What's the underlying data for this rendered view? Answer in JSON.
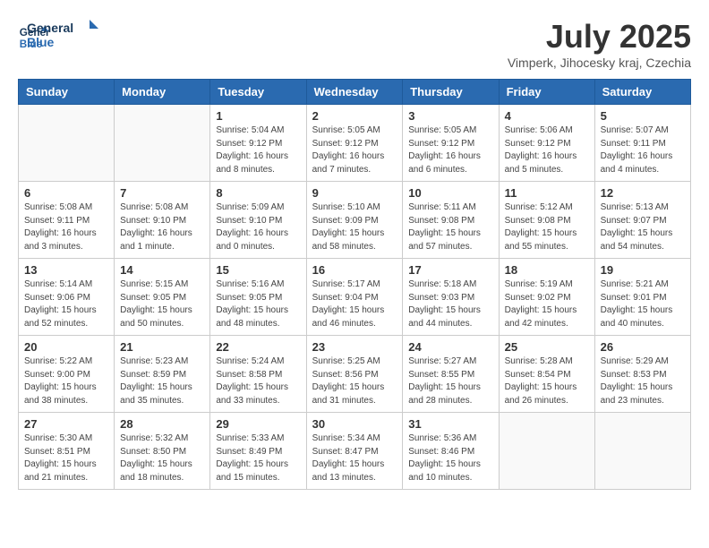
{
  "header": {
    "logo_line1": "General",
    "logo_line2": "Blue",
    "month": "July 2025",
    "location": "Vimperk, Jihocesky kraj, Czechia"
  },
  "weekdays": [
    "Sunday",
    "Monday",
    "Tuesday",
    "Wednesday",
    "Thursday",
    "Friday",
    "Saturday"
  ],
  "weeks": [
    [
      {
        "day": "",
        "info": ""
      },
      {
        "day": "",
        "info": ""
      },
      {
        "day": "1",
        "info": "Sunrise: 5:04 AM\nSunset: 9:12 PM\nDaylight: 16 hours and 8 minutes."
      },
      {
        "day": "2",
        "info": "Sunrise: 5:05 AM\nSunset: 9:12 PM\nDaylight: 16 hours and 7 minutes."
      },
      {
        "day": "3",
        "info": "Sunrise: 5:05 AM\nSunset: 9:12 PM\nDaylight: 16 hours and 6 minutes."
      },
      {
        "day": "4",
        "info": "Sunrise: 5:06 AM\nSunset: 9:12 PM\nDaylight: 16 hours and 5 minutes."
      },
      {
        "day": "5",
        "info": "Sunrise: 5:07 AM\nSunset: 9:11 PM\nDaylight: 16 hours and 4 minutes."
      }
    ],
    [
      {
        "day": "6",
        "info": "Sunrise: 5:08 AM\nSunset: 9:11 PM\nDaylight: 16 hours and 3 minutes."
      },
      {
        "day": "7",
        "info": "Sunrise: 5:08 AM\nSunset: 9:10 PM\nDaylight: 16 hours and 1 minute."
      },
      {
        "day": "8",
        "info": "Sunrise: 5:09 AM\nSunset: 9:10 PM\nDaylight: 16 hours and 0 minutes."
      },
      {
        "day": "9",
        "info": "Sunrise: 5:10 AM\nSunset: 9:09 PM\nDaylight: 15 hours and 58 minutes."
      },
      {
        "day": "10",
        "info": "Sunrise: 5:11 AM\nSunset: 9:08 PM\nDaylight: 15 hours and 57 minutes."
      },
      {
        "day": "11",
        "info": "Sunrise: 5:12 AM\nSunset: 9:08 PM\nDaylight: 15 hours and 55 minutes."
      },
      {
        "day": "12",
        "info": "Sunrise: 5:13 AM\nSunset: 9:07 PM\nDaylight: 15 hours and 54 minutes."
      }
    ],
    [
      {
        "day": "13",
        "info": "Sunrise: 5:14 AM\nSunset: 9:06 PM\nDaylight: 15 hours and 52 minutes."
      },
      {
        "day": "14",
        "info": "Sunrise: 5:15 AM\nSunset: 9:05 PM\nDaylight: 15 hours and 50 minutes."
      },
      {
        "day": "15",
        "info": "Sunrise: 5:16 AM\nSunset: 9:05 PM\nDaylight: 15 hours and 48 minutes."
      },
      {
        "day": "16",
        "info": "Sunrise: 5:17 AM\nSunset: 9:04 PM\nDaylight: 15 hours and 46 minutes."
      },
      {
        "day": "17",
        "info": "Sunrise: 5:18 AM\nSunset: 9:03 PM\nDaylight: 15 hours and 44 minutes."
      },
      {
        "day": "18",
        "info": "Sunrise: 5:19 AM\nSunset: 9:02 PM\nDaylight: 15 hours and 42 minutes."
      },
      {
        "day": "19",
        "info": "Sunrise: 5:21 AM\nSunset: 9:01 PM\nDaylight: 15 hours and 40 minutes."
      }
    ],
    [
      {
        "day": "20",
        "info": "Sunrise: 5:22 AM\nSunset: 9:00 PM\nDaylight: 15 hours and 38 minutes."
      },
      {
        "day": "21",
        "info": "Sunrise: 5:23 AM\nSunset: 8:59 PM\nDaylight: 15 hours and 35 minutes."
      },
      {
        "day": "22",
        "info": "Sunrise: 5:24 AM\nSunset: 8:58 PM\nDaylight: 15 hours and 33 minutes."
      },
      {
        "day": "23",
        "info": "Sunrise: 5:25 AM\nSunset: 8:56 PM\nDaylight: 15 hours and 31 minutes."
      },
      {
        "day": "24",
        "info": "Sunrise: 5:27 AM\nSunset: 8:55 PM\nDaylight: 15 hours and 28 minutes."
      },
      {
        "day": "25",
        "info": "Sunrise: 5:28 AM\nSunset: 8:54 PM\nDaylight: 15 hours and 26 minutes."
      },
      {
        "day": "26",
        "info": "Sunrise: 5:29 AM\nSunset: 8:53 PM\nDaylight: 15 hours and 23 minutes."
      }
    ],
    [
      {
        "day": "27",
        "info": "Sunrise: 5:30 AM\nSunset: 8:51 PM\nDaylight: 15 hours and 21 minutes."
      },
      {
        "day": "28",
        "info": "Sunrise: 5:32 AM\nSunset: 8:50 PM\nDaylight: 15 hours and 18 minutes."
      },
      {
        "day": "29",
        "info": "Sunrise: 5:33 AM\nSunset: 8:49 PM\nDaylight: 15 hours and 15 minutes."
      },
      {
        "day": "30",
        "info": "Sunrise: 5:34 AM\nSunset: 8:47 PM\nDaylight: 15 hours and 13 minutes."
      },
      {
        "day": "31",
        "info": "Sunrise: 5:36 AM\nSunset: 8:46 PM\nDaylight: 15 hours and 10 minutes."
      },
      {
        "day": "",
        "info": ""
      },
      {
        "day": "",
        "info": ""
      }
    ]
  ]
}
